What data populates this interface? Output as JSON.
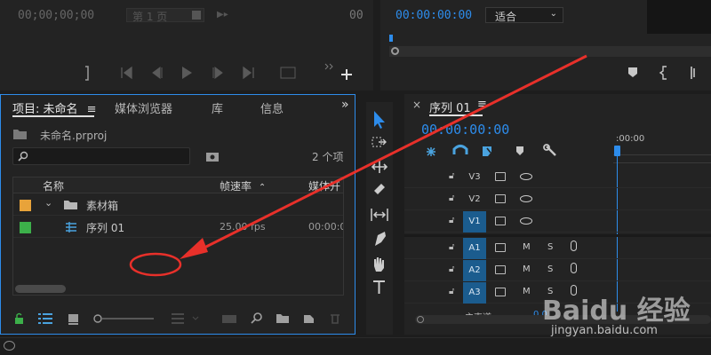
{
  "source_monitor": {
    "timecode": "00;00;00;00",
    "page_label": "第 1 页",
    "duration": "00"
  },
  "program_monitor": {
    "timecode": "00:00:00:00",
    "fit_option": "适合"
  },
  "project_panel": {
    "tabs": [
      {
        "label": "项目: 未命名",
        "active": true
      },
      {
        "label": "媒体浏览器",
        "active": false
      },
      {
        "label": "库",
        "active": false
      },
      {
        "label": "信息",
        "active": false
      }
    ],
    "project_file": "未命名.prproj",
    "search_placeholder": "",
    "item_count": "2 个项",
    "columns": {
      "name": "名称",
      "frame_rate": "帧速率",
      "media_start": "媒体开"
    },
    "rows": [
      {
        "name": "素材箱",
        "type": "bin",
        "color": "#e8a33a",
        "frame_rate": "",
        "media_start": ""
      },
      {
        "name": "序列 01",
        "type": "sequence",
        "color": "#3cb04a",
        "frame_rate": "25.00 fps",
        "media_start": "00:00:00"
      }
    ]
  },
  "timeline": {
    "sequence_tab": "序列 01",
    "timecode": "00:00:00:00",
    "ruler_start": ":00:00",
    "video_tracks": [
      {
        "label": "V3",
        "target": false
      },
      {
        "label": "V2",
        "target": false
      },
      {
        "label": "V1",
        "target": true
      }
    ],
    "audio_tracks": [
      {
        "label": "A1",
        "m": "M",
        "s": "S"
      },
      {
        "label": "A2",
        "m": "M",
        "s": "S"
      },
      {
        "label": "A3",
        "m": "M",
        "s": "S"
      }
    ],
    "master_label": "主声道",
    "master_value": "0.0"
  },
  "watermark": {
    "brand": "Baidu 经验",
    "url": "jingyan.baidu.com"
  },
  "annotation": {
    "color": "#e8302a"
  }
}
